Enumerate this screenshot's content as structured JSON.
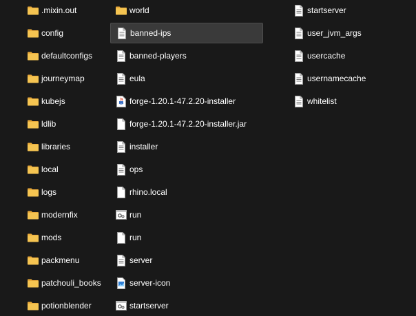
{
  "column1": [
    {
      "label": ".mixin.out",
      "icon": "folder-icon"
    },
    {
      "label": "config",
      "icon": "folder-icon"
    },
    {
      "label": "defaultconfigs",
      "icon": "folder-icon"
    },
    {
      "label": "journeymap",
      "icon": "folder-icon"
    },
    {
      "label": "kubejs",
      "icon": "folder-icon"
    },
    {
      "label": "ldlib",
      "icon": "folder-icon"
    },
    {
      "label": "libraries",
      "icon": "folder-icon"
    },
    {
      "label": "local",
      "icon": "folder-icon"
    },
    {
      "label": "logs",
      "icon": "folder-icon"
    },
    {
      "label": "modernfix",
      "icon": "folder-icon"
    },
    {
      "label": "mods",
      "icon": "folder-icon"
    },
    {
      "label": "packmenu",
      "icon": "folder-icon"
    },
    {
      "label": "patchouli_books",
      "icon": "folder-icon"
    },
    {
      "label": "potionblender",
      "icon": "folder-icon"
    }
  ],
  "column2": [
    {
      "label": "world",
      "icon": "folder-icon"
    },
    {
      "label": "banned-ips",
      "icon": "text-file-icon",
      "selected": true
    },
    {
      "label": "banned-players",
      "icon": "text-file-icon"
    },
    {
      "label": "eula",
      "icon": "text-file-icon"
    },
    {
      "label": "forge-1.20.1-47.2.20-installer",
      "icon": "java-file-icon"
    },
    {
      "label": "forge-1.20.1-47.2.20-installer.jar",
      "icon": "blank-file-icon"
    },
    {
      "label": "installer",
      "icon": "text-file-icon"
    },
    {
      "label": "ops",
      "icon": "text-file-icon"
    },
    {
      "label": "rhino.local",
      "icon": "blank-file-icon"
    },
    {
      "label": "run",
      "icon": "batch-file-icon"
    },
    {
      "label": "run",
      "icon": "blank-file-icon"
    },
    {
      "label": "server",
      "icon": "text-file-icon"
    },
    {
      "label": "server-icon",
      "icon": "image-file-icon"
    },
    {
      "label": "startserver",
      "icon": "batch-file-icon"
    }
  ],
  "column3": [
    {
      "label": "startserver",
      "icon": "text-file-icon"
    },
    {
      "label": "user_jvm_args",
      "icon": "text-file-icon"
    },
    {
      "label": "usercache",
      "icon": "text-file-icon"
    },
    {
      "label": "usernamecache",
      "icon": "text-file-icon"
    },
    {
      "label": "whitelist",
      "icon": "text-file-icon"
    }
  ],
  "colors": {
    "background": "#191919",
    "selected": "#3a3a3a",
    "folder": "#f2c14e",
    "text": "#ffffff"
  }
}
